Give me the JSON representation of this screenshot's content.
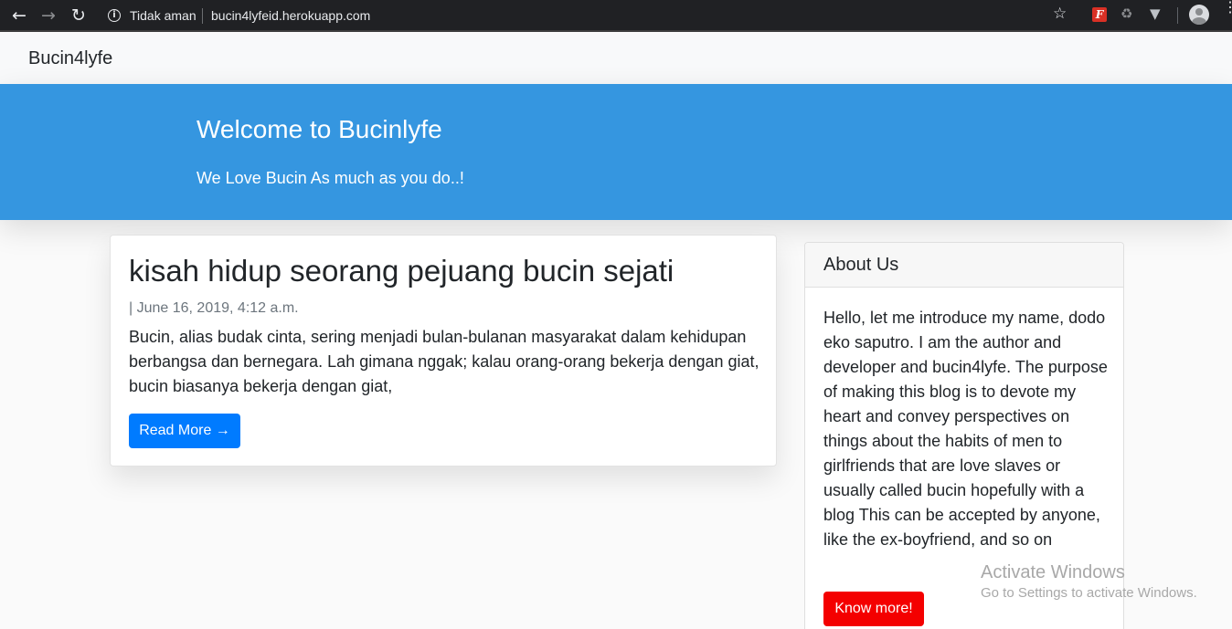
{
  "browser": {
    "security_label": "Tidak aman",
    "url": "bucin4lyfeid.herokuapp.com",
    "icons": {
      "back": "arrow-left-icon",
      "forward": "arrow-right-icon",
      "reload": "reload-icon",
      "info": "info-icon",
      "bookmark": "star-icon",
      "extension_1": "extension-red-f-icon",
      "extension_2": "extension-recycle-icon",
      "extension_3": "extension-v-icon",
      "profile": "avatar-icon",
      "menu": "kebab-menu-icon"
    }
  },
  "navbar": {
    "brand": "Bucin4lyfe"
  },
  "hero": {
    "title": "Welcome to Bucinlyfe",
    "subtitle": "We Love Bucin As much as you do..!",
    "background_color": "#3596e0"
  },
  "post": {
    "title": "kisah hidup seorang pejuang bucin sejati",
    "meta": "| June 16, 2019, 4:12 a.m.",
    "excerpt": "Bucin, alias budak cinta, sering menjadi bulan-bulanan masyarakat dalam kehidupan berbangsa dan bernegara. Lah gimana nggak; kalau orang-orang bekerja dengan giat, bucin biasanya bekerja dengan giat,",
    "read_more_label": "Read More →",
    "button_color": "#007bff"
  },
  "sidebar": {
    "title": "About Us",
    "text": "Hello, let me introduce my name, dodo eko saputro. I am the author and developer and bucin4lyfe. The purpose of making this blog is to devote my heart and convey perspectives on things about the habits of men to girlfriends that are love slaves or usually called bucin hopefully with a blog This can be accepted by anyone, like the ex-boyfriend, and so on",
    "button_label": "Know more!",
    "button_color": "#f40000"
  },
  "watermark": {
    "title": "Activate Windows",
    "subtitle": "Go to Settings to activate Windows."
  }
}
